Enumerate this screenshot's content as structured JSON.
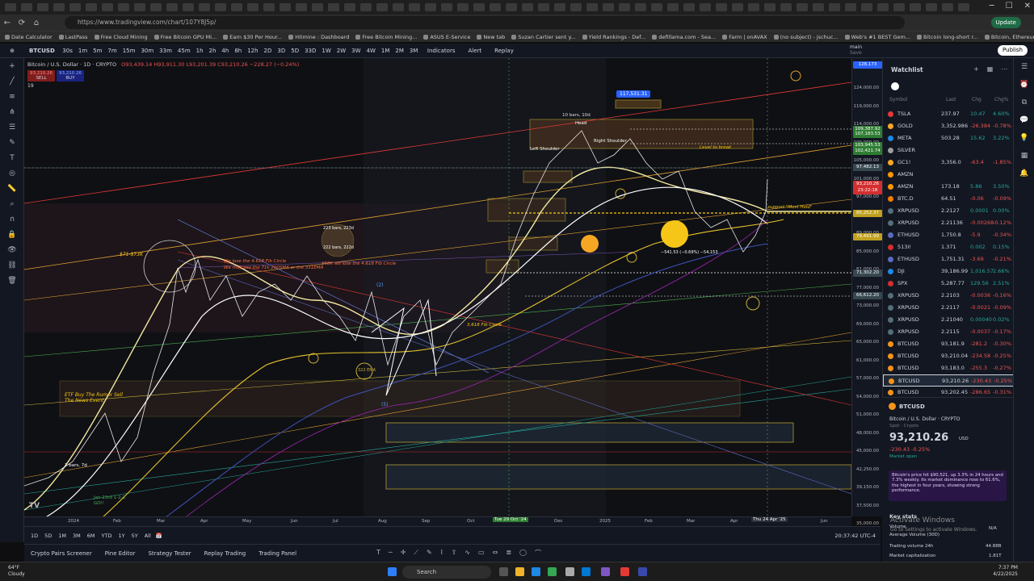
{
  "browser": {
    "url": "https://www.tradingview.com/chart/107Y8J5p/",
    "update_label": "Update"
  },
  "bookmarks": [
    "Date Calculator",
    "LastPass",
    "Free Cloud Mining",
    "Free Bitcoin GPU Mi...",
    "Earn $30 Per Hour...",
    "Hitmine : Dashboard",
    "Free Bitcoin Mining...",
    "ASUS E-Service",
    "New tab",
    "Suzan Cartier sent y...",
    "Yield Rankings - Def...",
    "defillama.com - Sea...",
    "Farm | onAVAX",
    "(no subject) - jschuc...",
    "Web's #1 BEST Gem...",
    "Bitcoin long-short r...",
    "Bitcoin, Ethereum, a...",
    "Other favorites"
  ],
  "toolbar": {
    "symbol": "BTCUSD",
    "timeframes": [
      "30s",
      "1m",
      "5m",
      "7m",
      "15m",
      "30m",
      "33m",
      "45m",
      "1h",
      "2h",
      "4h",
      "8h",
      "12h",
      "2D",
      "3D",
      "5D",
      "33D",
      "1W",
      "2W",
      "3W",
      "4W",
      "1M",
      "2M",
      "3M"
    ],
    "active_tf": "1D",
    "indicators": "Indicators",
    "alert": "Alert",
    "replay": "Replay",
    "layout": "main",
    "layout_sub": "Save",
    "publish": "Publish"
  },
  "legend": {
    "title": "Bitcoin / U.S. Dollar · 1D · CRYPTO",
    "ohlc": "O93,439.14 H93,911.30 L93,201.39 C93,210.26 −228.27 (−0.24%)",
    "sell": "93,210.26",
    "sell_label": "SELL",
    "buy": "93,210.26",
    "buy_label": "BUY",
    "count": "19"
  },
  "annotations": {
    "top_box": "117,531.31",
    "head": "Head",
    "bars_10": "10 bars, 10d",
    "left_shoulder": "Left Shoulder",
    "right_shoulder": "Right Shoulder",
    "level_to_break": "Level to break",
    "support": "support \"Must Hold\"",
    "drop": "−541.53 (−0.69%) −54,153",
    "bars_223": "223 bars, 223d",
    "bars_222": "222 bars, 222d",
    "range_71_73k": "$71-$73K",
    "fib_lost": "We lose the 4.618 Fib Circle",
    "fib_see": "We may see the 71k 200SMA or the 331EMA",
    "k58": "$58K we lose the 4.618 Fib Circle",
    "fib_circle": "3.618 Fib Circle",
    "etf": "ETF Buy The Rumor Sell The News Event",
    "bars_7": "7 bars, 7d",
    "jan23": "Jan 23rd 1-2-3 GO!!",
    "wave5": "(5)",
    "wave2": "(2)",
    "ema322": "322 EMA"
  },
  "price_axis": {
    "labels": [
      "124,000.00",
      "119,000.00",
      "114,000.00",
      "109,000.00",
      "105,000.00",
      "101,000.00",
      "97,000.00",
      "93,000.00",
      "89,000.00",
      "85,000.00",
      "81,000.00",
      "77,000.00",
      "73,000.00",
      "69,000.00",
      "65,000.00",
      "61,000.00",
      "57,000.00",
      "54,000.00",
      "51,000.00",
      "48,000.00",
      "45,000.00",
      "42,250.00",
      "39,150.00",
      "37,500.00",
      "35,000.00"
    ],
    "top_tag": "128,173",
    "currency": "USD",
    "tags": [
      {
        "text": "109,387.92",
        "color": "#2e7d32"
      },
      {
        "text": "107,183.53",
        "color": "#2e7d32"
      },
      {
        "text": "103,945.53",
        "color": "#2e7d32"
      },
      {
        "text": "102,421.74",
        "color": "#2e7d32"
      },
      {
        "text": "97,482.13",
        "color": "#37474f"
      },
      {
        "text": "93,210.26",
        "color": "#d32f2f"
      },
      {
        "text": "23:22:18",
        "color": "#d32f2f"
      },
      {
        "text": "85,252.37",
        "color": "#c0a020"
      },
      {
        "text": "79,491.99",
        "color": "#c0a020"
      },
      {
        "text": "71,302.20",
        "color": "#37474f"
      },
      {
        "text": "66,612.20",
        "color": "#37474f"
      }
    ]
  },
  "time_axis": {
    "labels": [
      "2024",
      "Feb",
      "Mar",
      "Apr",
      "May",
      "Jun",
      "Jul",
      "Aug",
      "Sep",
      "Oct",
      "Dec",
      "2025",
      "Feb",
      "Mar",
      "Apr",
      "Jun"
    ],
    "highlight1": "Tue 29 Oct '24",
    "highlight2": "Thu 24 Apr '25"
  },
  "ranges": [
    "1D",
    "5D",
    "1M",
    "3M",
    "6M",
    "YTD",
    "1Y",
    "5Y",
    "All"
  ],
  "utc": "20:37:42 UTC-4",
  "bottom_tabs": [
    "Crypto Pairs Screener",
    "Pine Editor",
    "Strategy Tester",
    "Replay Trading",
    "Trading Panel"
  ],
  "watchlist": {
    "title": "Watchlist",
    "columns": {
      "symbol": "Symbol",
      "last": "Last",
      "chg": "Chg",
      "chgp": "Chg%"
    },
    "rows": [
      {
        "sym": "TSLA",
        "last": "237.97",
        "chg": "10.47",
        "chgp": "4.60%",
        "color": "#e53935",
        "up": true
      },
      {
        "sym": "GOLD",
        "last": "3,352.986",
        "chg": "-26.384",
        "chgp": "-0.78%",
        "color": "#f9a825",
        "up": false
      },
      {
        "sym": "META",
        "last": "503.28",
        "chg": "15.62",
        "chgp": "3.22%",
        "color": "#1e88e5",
        "up": true
      },
      {
        "sym": "SILVER",
        "last": "",
        "chg": "",
        "chgp": "",
        "color": "#9e9e9e",
        "up": false
      },
      {
        "sym": "GC1!",
        "last": "3,356.0",
        "chg": "-63.4",
        "chgp": "-1.85%",
        "color": "#f9a825",
        "up": false
      },
      {
        "sym": "AMZN",
        "last": "",
        "chg": "",
        "chgp": "",
        "color": "#ff9800",
        "up": false
      },
      {
        "sym": "AMZN",
        "last": "173.18",
        "chg": "5.86",
        "chgp": "3.50%",
        "color": "#ff9800",
        "up": true
      },
      {
        "sym": "BTC.D",
        "last": "64.51",
        "chg": "-0.06",
        "chgp": "-0.09%",
        "color": "#f57c00",
        "up": false
      },
      {
        "sym": "XRPUSD",
        "last": "2.2127",
        "chg": "0.0001",
        "chgp": "0.00%",
        "color": "#546e7a",
        "up": true
      },
      {
        "sym": "XRPUSD",
        "last": "2.21136",
        "chg": "-0.00268",
        "chgp": "-0.12%",
        "color": "#546e7a",
        "up": false
      },
      {
        "sym": "ETHUSD",
        "last": "1,750.8",
        "chg": "-5.9",
        "chgp": "-0.34%",
        "color": "#5c6bc0",
        "up": false
      },
      {
        "sym": "513I!",
        "last": "1.371",
        "chg": "0.002",
        "chgp": "0.15%",
        "color": "#d32f2f",
        "up": true
      },
      {
        "sym": "ETHUSD",
        "last": "1,751.31",
        "chg": "-3.69",
        "chgp": "-0.21%",
        "color": "#5c6bc0",
        "up": false
      },
      {
        "sym": "DJI",
        "last": "39,186.99",
        "chg": "1,016.57",
        "chgp": "2.66%",
        "color": "#1e88e5",
        "up": true
      },
      {
        "sym": "SPX",
        "last": "5,287.77",
        "chg": "129.56",
        "chgp": "2.51%",
        "color": "#d32f2f",
        "up": true
      },
      {
        "sym": "XRPUSD",
        "last": "2.2103",
        "chg": "-0.0036",
        "chgp": "-0.16%",
        "color": "#546e7a",
        "up": false
      },
      {
        "sym": "XRPUSD",
        "last": "2.2117",
        "chg": "-0.0021",
        "chgp": "-0.09%",
        "color": "#546e7a",
        "up": false
      },
      {
        "sym": "XRPUSD",
        "last": "2.21040",
        "chg": "0.00040",
        "chgp": "0.02%",
        "color": "#546e7a",
        "up": true
      },
      {
        "sym": "XRPUSD",
        "last": "2.2115",
        "chg": "-0.0037",
        "chgp": "-0.17%",
        "color": "#546e7a",
        "up": false
      },
      {
        "sym": "BTCUSD",
        "last": "93,181.9",
        "chg": "-281.2",
        "chgp": "-0.30%",
        "color": "#f7931a",
        "up": false
      },
      {
        "sym": "BTCUSD",
        "last": "93,210.04",
        "chg": "-234.58",
        "chgp": "-0.25%",
        "color": "#f7931a",
        "up": false
      },
      {
        "sym": "BTCUSD",
        "last": "93,183.0",
        "chg": "-255.3",
        "chgp": "-0.27%",
        "color": "#f7931a",
        "up": false
      },
      {
        "sym": "BTCUSD",
        "last": "93,210.26",
        "chg": "-230.43",
        "chgp": "-0.25%",
        "color": "#f7931a",
        "up": false
      },
      {
        "sym": "BTCUSD",
        "last": "93,202.45",
        "chg": "-286.65",
        "chgp": "-0.31%",
        "color": "#f7931a",
        "up": false
      }
    ]
  },
  "detail": {
    "symbol": "BTCUSD",
    "name": "Bitcoin / U.S. Dollar · CRYPTO",
    "type": "Spot · Crypto",
    "price": "93,210.26",
    "currency": "USD",
    "change": "-230.43 -0.25%",
    "status": "Market open",
    "news": "Bitcoin's price hit $90,521, up 3.3% in 24 hours and 7.3% weekly. Its market dominance rose to 61.6%, the highest in four years, showing strong performance.",
    "keystats": "Key stats",
    "volume_label": "Volume",
    "avg_vol": "Average Volume (30D)",
    "avg_vol_val": "N/A",
    "tv24": "Trading volume 24h",
    "tv24_val": "44.88B",
    "mcap": "Market capitalization",
    "mcap_val": "1.81T"
  },
  "activate": {
    "line1": "Activate Windows",
    "line2": "Go to Settings to activate Windows."
  },
  "taskbar": {
    "temp": "64°F",
    "weather": "Cloudy",
    "search": "Search",
    "time": "7:37 PM",
    "date": "4/22/2025"
  }
}
